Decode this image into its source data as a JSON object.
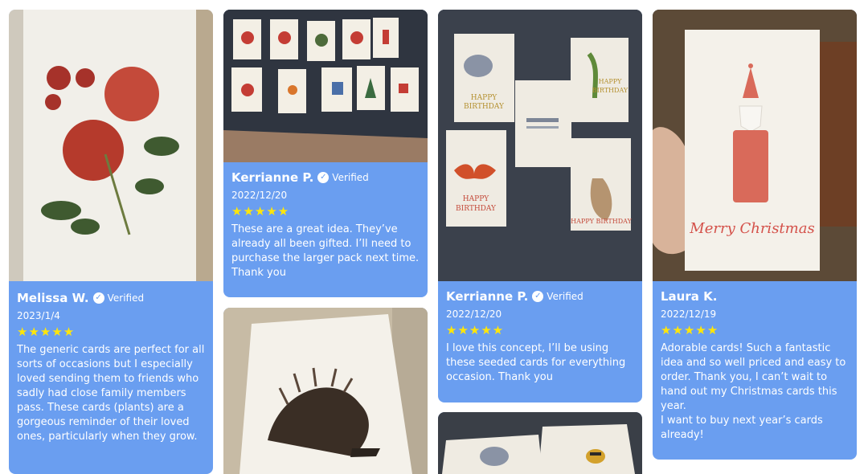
{
  "verified_label": "Verified",
  "stars": "★★★★★",
  "reviews": [
    {
      "name": "Melissa W.",
      "date": "2023/1/4",
      "text": "The generic cards are perfect for all sorts of occasions but I especially loved sending them to friends who sadly had close family members pass. These cards (plants) are a gorgeous reminder of their loved ones, particularly when they grow."
    },
    {
      "name": "Kerrianne P.",
      "date": "2022/12/20",
      "text": "These are a great idea. They’ve already all been gifted. I’ll need to purchase the larger pack next time. Thank you"
    },
    {
      "name": "Kerrianne P.",
      "date": "2022/12/20",
      "text": "I love this concept, I’ll be using these seeded cards for everything occasion. Thank you"
    },
    {
      "name": "Laura K.",
      "date": "2022/12/19",
      "text": "Adorable cards! Such a fantastic idea and so well priced and easy to order. Thank you, I can’t wait to hand out my Christmas cards this year.\nI want to buy next year’s cards already!"
    }
  ],
  "photo_text": {
    "happy_birthday": "HAPPY BIRTHDAY",
    "merry_christmas": "Merry Christmas"
  }
}
